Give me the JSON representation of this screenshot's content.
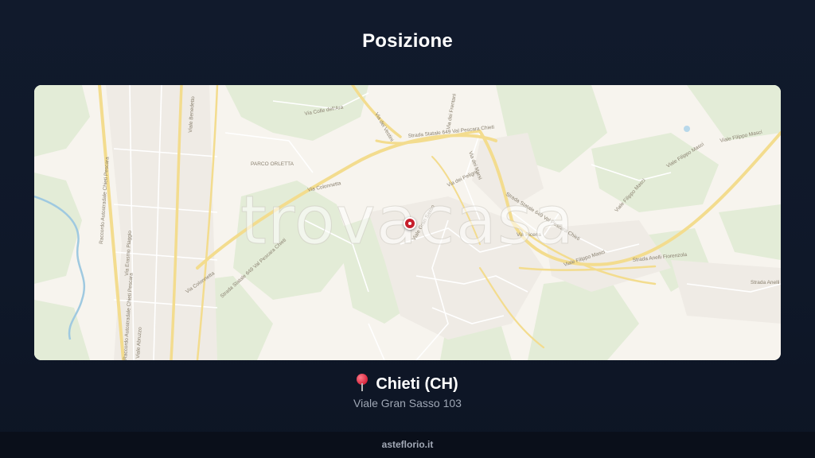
{
  "header": {
    "title": "Posizione"
  },
  "map": {
    "watermark": "trovacasa",
    "road_labels": {
      "raccordo_1": "Raccordo Autostradale Chieti Pescara",
      "raccordo_2": "Raccordo Autostradale Chieti Pescara",
      "via_colonnetta_1": "Via Colonnetta",
      "via_colonnetta_2": "Via Colonnetta",
      "ss649_1": "Strada Statale 649 Val Pescara Chieti",
      "ss649_2": "Strada Statale 649 Val Pescara Chieti",
      "ss649_3": "Strada Statale 649 Val Pescara Chieti",
      "via_picena": "Via Picena",
      "via_filippo_masci_1": "Viale Filippo Masci",
      "via_filippo_masci_2": "Viale Filippo Masci",
      "via_filippo_masci_3": "Viale Filippo Masci",
      "via_filippo_masci_4": "Viale Filippo Masci",
      "via_abruzzo": "Viale Abruzzo",
      "via_benedetto": "Viale Benedetto",
      "via_piaggio": "Via Erasmo Piaggio",
      "via_frentani": "Via dei Frentani",
      "via_vestini": "Via dei Vestini",
      "via_marsi": "Via dei Marsi",
      "via_peligni": "Via dei Peligni",
      "via_gran_sasso": "Viale Gran Sasso",
      "strada_anelli": "Strada Anelli Fiorenzola",
      "strada_anelli_2": "Strada Anelli",
      "via_arco": "Via Colle dell'Ara",
      "parco": "PARCO ORLETTA"
    },
    "marker_color": "#c61f2c"
  },
  "location": {
    "pin_icon": "round-pushpin-icon",
    "city": "Chieti (CH)",
    "address": "Viale Gran Sasso 103"
  },
  "footer": {
    "site": "asteflorio.it"
  }
}
